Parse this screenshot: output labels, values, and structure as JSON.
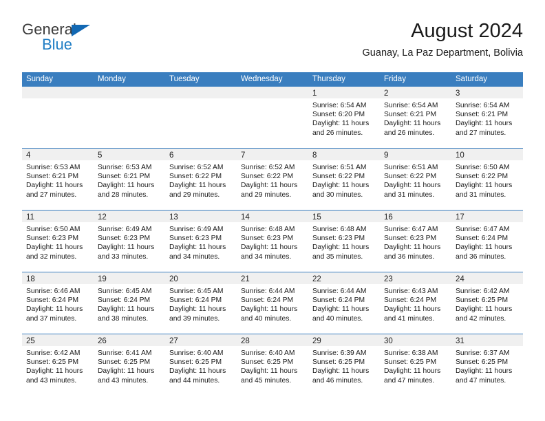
{
  "brand": {
    "name_part1": "General",
    "name_part2": "Blue",
    "accent_color": "#1268b3",
    "blue_text_color": "#1f7dc4"
  },
  "header": {
    "month_title": "August 2024",
    "location": "Guanay, La Paz Department, Bolivia"
  },
  "calendar": {
    "header_bg": "#3a7ebf",
    "weekdays": [
      "Sunday",
      "Monday",
      "Tuesday",
      "Wednesday",
      "Thursday",
      "Friday",
      "Saturday"
    ],
    "weeks": [
      [
        {
          "day": "",
          "lines": []
        },
        {
          "day": "",
          "lines": []
        },
        {
          "day": "",
          "lines": []
        },
        {
          "day": "",
          "lines": []
        },
        {
          "day": "1",
          "lines": [
            "Sunrise: 6:54 AM",
            "Sunset: 6:20 PM",
            "Daylight: 11 hours",
            "and 26 minutes."
          ]
        },
        {
          "day": "2",
          "lines": [
            "Sunrise: 6:54 AM",
            "Sunset: 6:21 PM",
            "Daylight: 11 hours",
            "and 26 minutes."
          ]
        },
        {
          "day": "3",
          "lines": [
            "Sunrise: 6:54 AM",
            "Sunset: 6:21 PM",
            "Daylight: 11 hours",
            "and 27 minutes."
          ]
        }
      ],
      [
        {
          "day": "4",
          "lines": [
            "Sunrise: 6:53 AM",
            "Sunset: 6:21 PM",
            "Daylight: 11 hours",
            "and 27 minutes."
          ]
        },
        {
          "day": "5",
          "lines": [
            "Sunrise: 6:53 AM",
            "Sunset: 6:21 PM",
            "Daylight: 11 hours",
            "and 28 minutes."
          ]
        },
        {
          "day": "6",
          "lines": [
            "Sunrise: 6:52 AM",
            "Sunset: 6:22 PM",
            "Daylight: 11 hours",
            "and 29 minutes."
          ]
        },
        {
          "day": "7",
          "lines": [
            "Sunrise: 6:52 AM",
            "Sunset: 6:22 PM",
            "Daylight: 11 hours",
            "and 29 minutes."
          ]
        },
        {
          "day": "8",
          "lines": [
            "Sunrise: 6:51 AM",
            "Sunset: 6:22 PM",
            "Daylight: 11 hours",
            "and 30 minutes."
          ]
        },
        {
          "day": "9",
          "lines": [
            "Sunrise: 6:51 AM",
            "Sunset: 6:22 PM",
            "Daylight: 11 hours",
            "and 31 minutes."
          ]
        },
        {
          "day": "10",
          "lines": [
            "Sunrise: 6:50 AM",
            "Sunset: 6:22 PM",
            "Daylight: 11 hours",
            "and 31 minutes."
          ]
        }
      ],
      [
        {
          "day": "11",
          "lines": [
            "Sunrise: 6:50 AM",
            "Sunset: 6:23 PM",
            "Daylight: 11 hours",
            "and 32 minutes."
          ]
        },
        {
          "day": "12",
          "lines": [
            "Sunrise: 6:49 AM",
            "Sunset: 6:23 PM",
            "Daylight: 11 hours",
            "and 33 minutes."
          ]
        },
        {
          "day": "13",
          "lines": [
            "Sunrise: 6:49 AM",
            "Sunset: 6:23 PM",
            "Daylight: 11 hours",
            "and 34 minutes."
          ]
        },
        {
          "day": "14",
          "lines": [
            "Sunrise: 6:48 AM",
            "Sunset: 6:23 PM",
            "Daylight: 11 hours",
            "and 34 minutes."
          ]
        },
        {
          "day": "15",
          "lines": [
            "Sunrise: 6:48 AM",
            "Sunset: 6:23 PM",
            "Daylight: 11 hours",
            "and 35 minutes."
          ]
        },
        {
          "day": "16",
          "lines": [
            "Sunrise: 6:47 AM",
            "Sunset: 6:23 PM",
            "Daylight: 11 hours",
            "and 36 minutes."
          ]
        },
        {
          "day": "17",
          "lines": [
            "Sunrise: 6:47 AM",
            "Sunset: 6:24 PM",
            "Daylight: 11 hours",
            "and 36 minutes."
          ]
        }
      ],
      [
        {
          "day": "18",
          "lines": [
            "Sunrise: 6:46 AM",
            "Sunset: 6:24 PM",
            "Daylight: 11 hours",
            "and 37 minutes."
          ]
        },
        {
          "day": "19",
          "lines": [
            "Sunrise: 6:45 AM",
            "Sunset: 6:24 PM",
            "Daylight: 11 hours",
            "and 38 minutes."
          ]
        },
        {
          "day": "20",
          "lines": [
            "Sunrise: 6:45 AM",
            "Sunset: 6:24 PM",
            "Daylight: 11 hours",
            "and 39 minutes."
          ]
        },
        {
          "day": "21",
          "lines": [
            "Sunrise: 6:44 AM",
            "Sunset: 6:24 PM",
            "Daylight: 11 hours",
            "and 40 minutes."
          ]
        },
        {
          "day": "22",
          "lines": [
            "Sunrise: 6:44 AM",
            "Sunset: 6:24 PM",
            "Daylight: 11 hours",
            "and 40 minutes."
          ]
        },
        {
          "day": "23",
          "lines": [
            "Sunrise: 6:43 AM",
            "Sunset: 6:24 PM",
            "Daylight: 11 hours",
            "and 41 minutes."
          ]
        },
        {
          "day": "24",
          "lines": [
            "Sunrise: 6:42 AM",
            "Sunset: 6:25 PM",
            "Daylight: 11 hours",
            "and 42 minutes."
          ]
        }
      ],
      [
        {
          "day": "25",
          "lines": [
            "Sunrise: 6:42 AM",
            "Sunset: 6:25 PM",
            "Daylight: 11 hours",
            "and 43 minutes."
          ]
        },
        {
          "day": "26",
          "lines": [
            "Sunrise: 6:41 AM",
            "Sunset: 6:25 PM",
            "Daylight: 11 hours",
            "and 43 minutes."
          ]
        },
        {
          "day": "27",
          "lines": [
            "Sunrise: 6:40 AM",
            "Sunset: 6:25 PM",
            "Daylight: 11 hours",
            "and 44 minutes."
          ]
        },
        {
          "day": "28",
          "lines": [
            "Sunrise: 6:40 AM",
            "Sunset: 6:25 PM",
            "Daylight: 11 hours",
            "and 45 minutes."
          ]
        },
        {
          "day": "29",
          "lines": [
            "Sunrise: 6:39 AM",
            "Sunset: 6:25 PM",
            "Daylight: 11 hours",
            "and 46 minutes."
          ]
        },
        {
          "day": "30",
          "lines": [
            "Sunrise: 6:38 AM",
            "Sunset: 6:25 PM",
            "Daylight: 11 hours",
            "and 47 minutes."
          ]
        },
        {
          "day": "31",
          "lines": [
            "Sunrise: 6:37 AM",
            "Sunset: 6:25 PM",
            "Daylight: 11 hours",
            "and 47 minutes."
          ]
        }
      ]
    ]
  }
}
